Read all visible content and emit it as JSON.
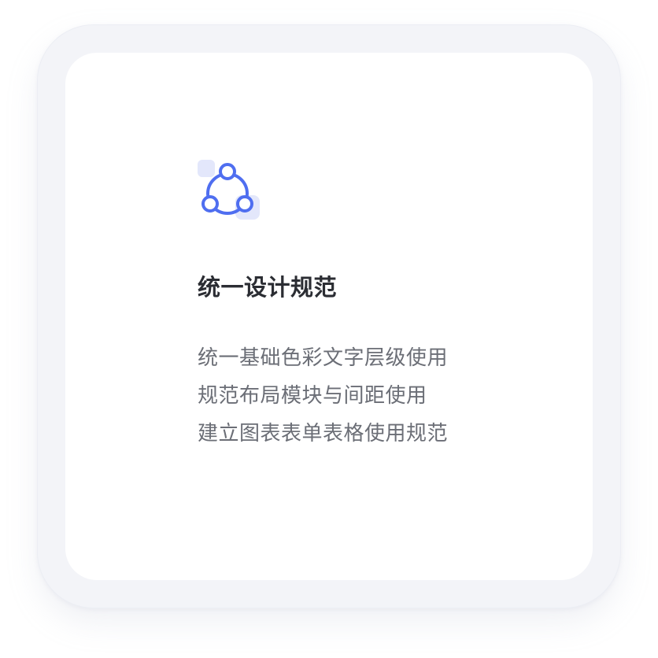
{
  "card": {
    "icon": "connection-nodes-icon",
    "title": "统一设计规范",
    "points": [
      "统一基础色彩文字层级使用",
      "规范布局模块与间距使用",
      "建立图表表单表格使用规范"
    ]
  },
  "colors": {
    "accent": "#4f6ef0",
    "accent_soft": "#e3e7fb",
    "frame": "#f3f4f8",
    "card": "#ffffff",
    "title": "#2b2d33",
    "body": "#6b6e76"
  }
}
